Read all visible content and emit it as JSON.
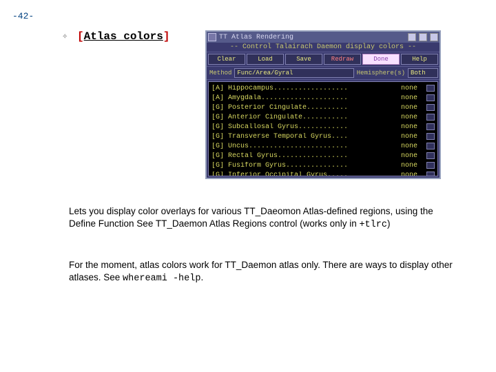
{
  "page_number": "-42-",
  "heading": {
    "open": "[",
    "text": "Atlas colors",
    "close": "]"
  },
  "dialog": {
    "title": "TT Atlas Rendering",
    "banner": "-- Control Talairach Daemon display colors --",
    "buttons": [
      "Clear",
      "Load",
      "Save",
      "Redraw",
      "Done",
      "Help"
    ],
    "method_label": "Method",
    "method_value": "Func/Area/Gyral",
    "hemi_label": "Hemisphere(s)",
    "hemi_value": "Both",
    "rows": [
      {
        "label": "[A] Hippocampus..................",
        "value": "none"
      },
      {
        "label": "[A] Amygdala.....................",
        "value": "none"
      },
      {
        "label": "[G] Posterior Cingulate..........",
        "value": "none"
      },
      {
        "label": "[G] Anterior Cingulate...........",
        "value": "none"
      },
      {
        "label": "[G] Subcallosal Gyrus............",
        "value": "none"
      },
      {
        "label": "[G] Transverse Temporal Gyrus....",
        "value": "none"
      },
      {
        "label": "[G] Uncus........................",
        "value": "none"
      },
      {
        "label": "[G] Rectal Gyrus.................",
        "value": "none"
      },
      {
        "label": "[G] Fusiform Gyrus...............",
        "value": "none"
      },
      {
        "label": "[G] Inferior Occipital Gyrus.....",
        "value": "none"
      }
    ]
  },
  "para1_a": "Lets you display color overlays for various TT_Daeomon Atlas-defined regions, using the Define Function  See TT_Daemon Atlas Regions control (works only in ",
  "para1_mono": "+tlrc",
  "para1_b": ")",
  "para2_a": "For the moment, atlas colors work for TT_Daemon atlas only. There are ways to display other atlases. See ",
  "para2_mono": "whereami -help",
  "para2_b": "."
}
